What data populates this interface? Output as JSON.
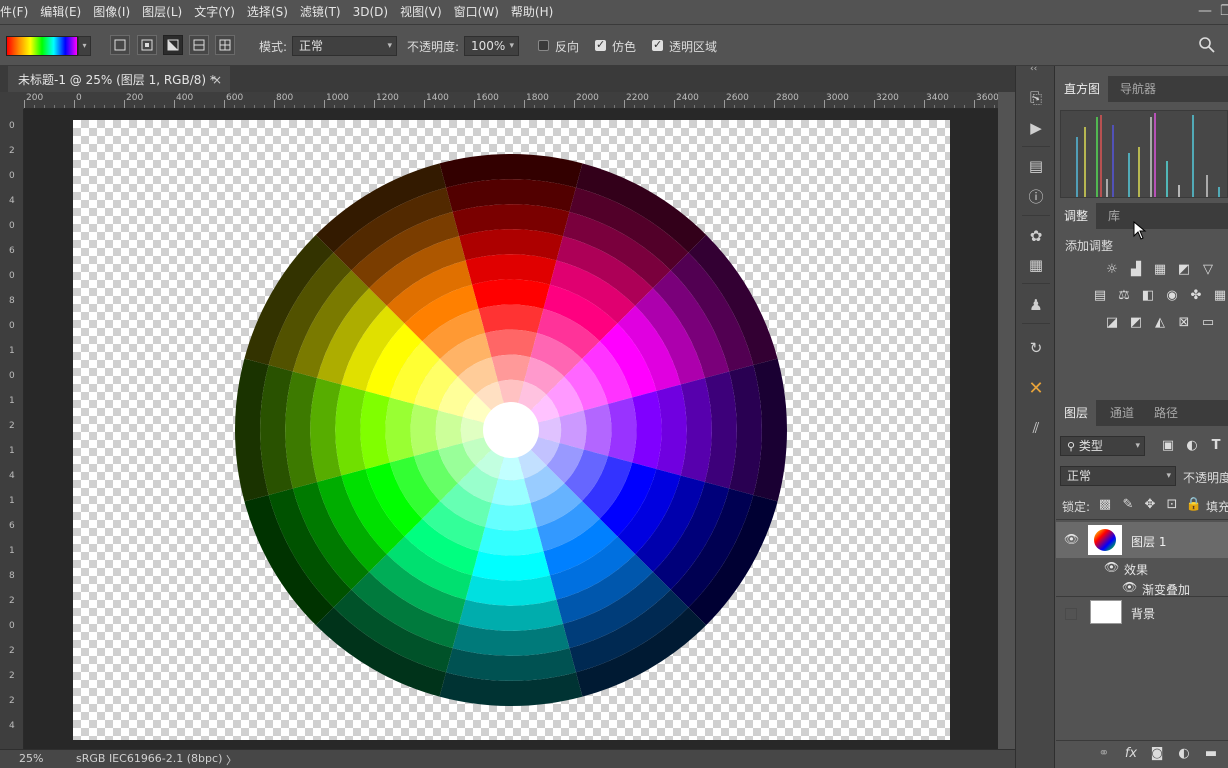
{
  "menu": {
    "items": [
      "件(F)",
      "编辑(E)",
      "图像(I)",
      "图层(L)",
      "文字(Y)",
      "选择(S)",
      "滤镜(T)",
      "3D(D)",
      "视图(V)",
      "窗口(W)",
      "帮助(H)"
    ]
  },
  "options": {
    "mode_label": "模式:",
    "mode_value": "正常",
    "opacity_label": "不透明度:",
    "opacity_value": "100%",
    "reverse_label": "反向",
    "dither_label": "仿色",
    "transparency_label": "透明区域"
  },
  "document": {
    "tab_title": "未标题-1 @ 25% (图层 1, RGB/8) *",
    "close_glyph": "×"
  },
  "ruler": {
    "h_ticks": [
      "200",
      "0",
      "200",
      "400",
      "600",
      "800",
      "1000",
      "1200",
      "1400",
      "1600",
      "1800",
      "2000",
      "2200",
      "2400",
      "2600",
      "2800",
      "3000",
      "3200",
      "3400",
      "3600"
    ],
    "v_ticks": [
      "0",
      "2",
      "0",
      "4",
      "0",
      "6",
      "0",
      "8",
      "0",
      "1",
      "0",
      "1",
      "2",
      "1",
      "4",
      "1",
      "6",
      "1",
      "8",
      "2",
      "0",
      "2",
      "2",
      "2",
      "4"
    ]
  },
  "status": {
    "zoom": "25%",
    "profile": "sRGB IEC61966-2.1 (8bpc)",
    "arrow": "〉"
  },
  "panels": {
    "histogram_tab": "直方图",
    "navigator_tab": "导航器",
    "adjust_tab": "调整",
    "library_tab": "库",
    "add_adjustment": "添加调整",
    "layers_tab": "图层",
    "channels_tab": "通道",
    "paths_tab": "路径",
    "filter_kind": "类型",
    "blend_mode": "正常",
    "opacity_label": "不透明度",
    "lock_label": "锁定:",
    "fill_label": "填充"
  },
  "layers": [
    {
      "name": "图层 1"
    },
    {
      "name": "效果"
    },
    {
      "name": "渐变叠加"
    },
    {
      "name": "背景"
    }
  ],
  "colors": {
    "panel_bg": "#535353",
    "workspace_bg": "#282828",
    "accent_orange": "#e8a33a"
  }
}
